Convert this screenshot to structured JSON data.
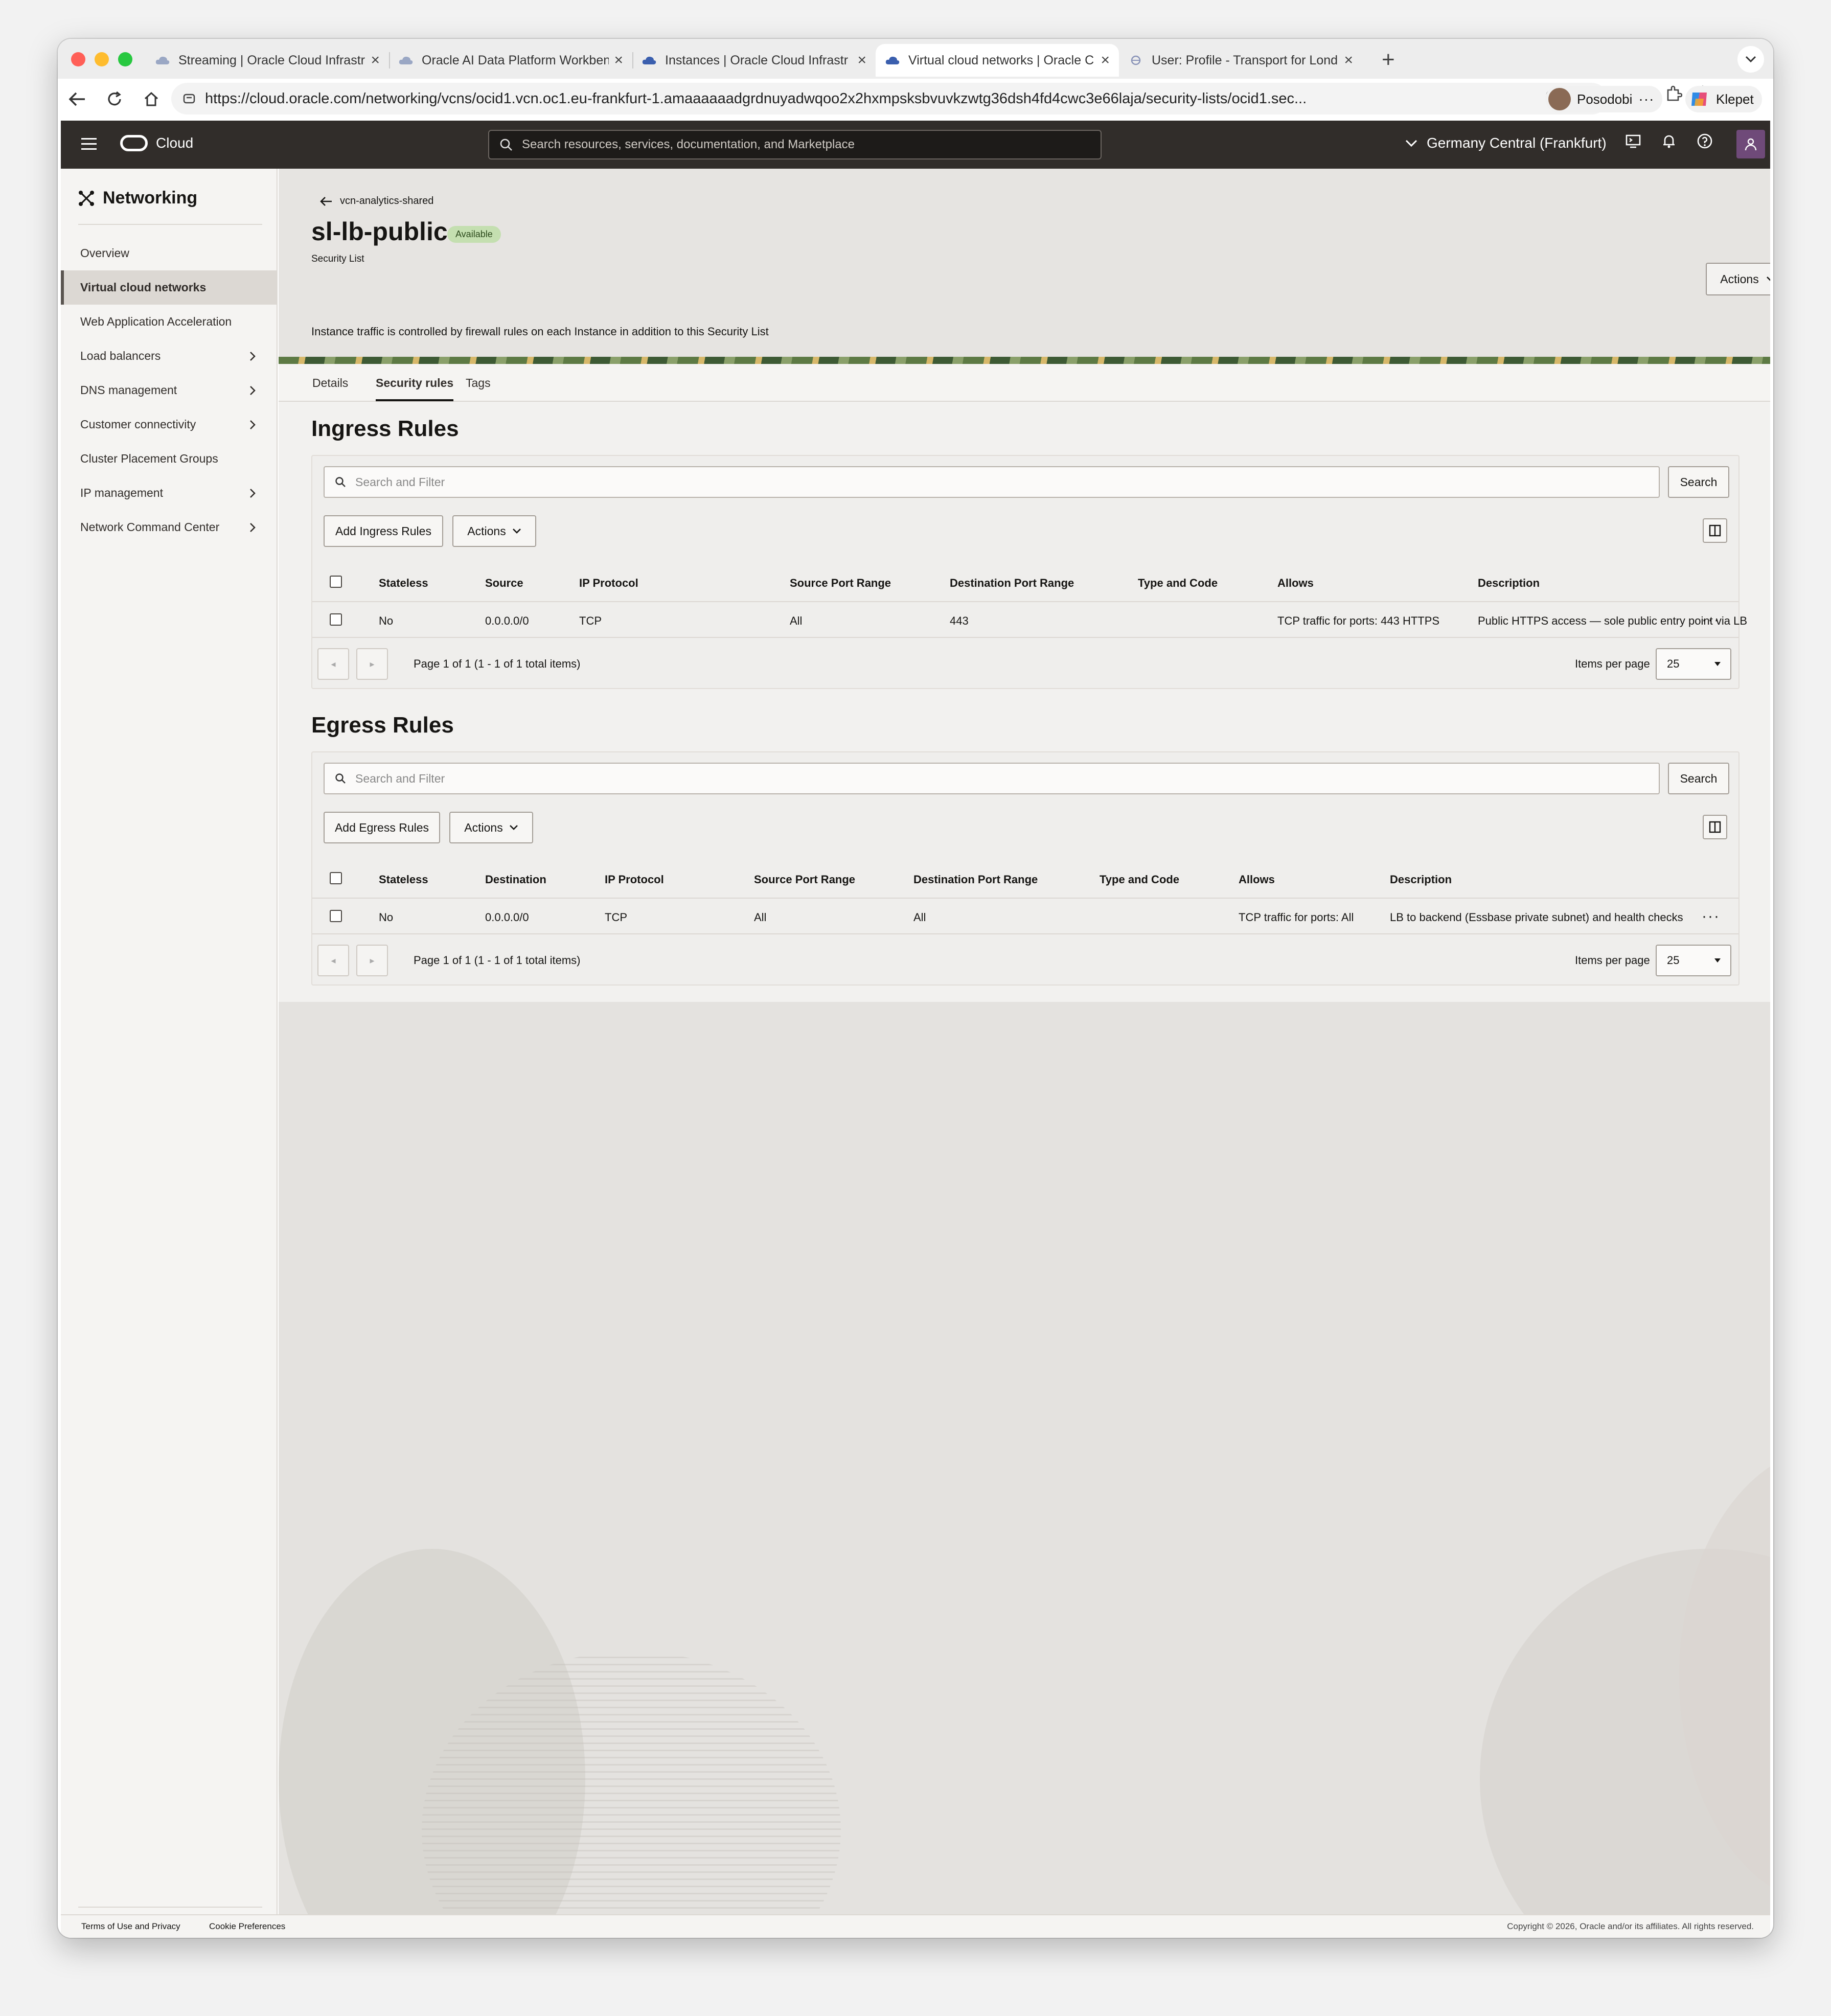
{
  "browser": {
    "tabs": [
      {
        "title": "Streaming | Oracle Cloud Infrastr",
        "active": false
      },
      {
        "title": "Oracle AI Data Platform Workben",
        "active": false
      },
      {
        "title": "Instances | Oracle Cloud Infrastr",
        "active": false
      },
      {
        "title": "Virtual cloud networks | Oracle C",
        "active": true
      },
      {
        "title": "User: Profile - Transport for Lond",
        "active": false
      }
    ],
    "url": "https://cloud.oracle.com/networking/vcns/ocid1.vcn.oc1.eu-frankfurt-1.amaaaaaadgrdnuyadwqoo2x2hxmpsksbvuvkzwtg36dsh4fd4cwc3e66laja/security-lists/ocid1.sec...",
    "profile_name": "Posodobi",
    "copilot_label": "Klepet"
  },
  "header": {
    "brand": "Cloud",
    "search_placeholder": "Search resources, services, documentation, and Marketplace",
    "region": "Germany Central (Frankfurt)"
  },
  "sidebar": {
    "title": "Networking",
    "items": [
      {
        "label": "Overview",
        "active": false,
        "has_children": false
      },
      {
        "label": "Virtual cloud networks",
        "active": true,
        "has_children": false
      },
      {
        "label": "Web Application Acceleration",
        "active": false,
        "has_children": false
      },
      {
        "label": "Load balancers",
        "active": false,
        "has_children": true
      },
      {
        "label": "DNS management",
        "active": false,
        "has_children": true
      },
      {
        "label": "Customer connectivity",
        "active": false,
        "has_children": true
      },
      {
        "label": "Cluster Placement Groups",
        "active": false,
        "has_children": false
      },
      {
        "label": "IP management",
        "active": false,
        "has_children": true
      },
      {
        "label": "Network Command Center",
        "active": false,
        "has_children": true
      }
    ]
  },
  "page": {
    "back_label": "vcn-analytics-shared",
    "title": "sl-lb-public",
    "status": "Available",
    "subtitle": "Security List",
    "description": "Instance traffic is controlled by firewall rules on each Instance in addition to this Security List",
    "actions_label": "Actions",
    "tabs": [
      "Details",
      "Security rules",
      "Tags"
    ],
    "active_tab": "Security rules"
  },
  "ingress": {
    "title": "Ingress Rules",
    "filter_placeholder": "Search and Filter",
    "search_label": "Search",
    "add_label": "Add Ingress Rules",
    "actions_label": "Actions",
    "columns": [
      "Stateless",
      "Source",
      "IP Protocol",
      "Source Port Range",
      "Destination Port Range",
      "Type and Code",
      "Allows",
      "Description"
    ],
    "rows": [
      [
        "No",
        "0.0.0.0/0",
        "TCP",
        "All",
        "443",
        "",
        "TCP traffic for ports: 443 HTTPS",
        "Public HTTPS access — sole public entry point via LB"
      ]
    ],
    "page_info": "Page 1 of 1 (1 - 1 of 1 total items)",
    "items_per_page_label": "Items per page",
    "items_per_page": "25"
  },
  "egress": {
    "title": "Egress Rules",
    "filter_placeholder": "Search and Filter",
    "search_label": "Search",
    "add_label": "Add Egress Rules",
    "actions_label": "Actions",
    "columns": [
      "Stateless",
      "Destination",
      "IP Protocol",
      "Source Port Range",
      "Destination Port Range",
      "Type and Code",
      "Allows",
      "Description"
    ],
    "rows": [
      [
        "No",
        "0.0.0.0/0",
        "TCP",
        "All",
        "All",
        "",
        "TCP traffic for ports: All",
        "LB to backend (Essbase private subnet) and health checks"
      ]
    ],
    "page_info": "Page 1 of 1 (1 - 1 of 1 total items)",
    "items_per_page_label": "Items per page",
    "items_per_page": "25"
  },
  "footer": {
    "terms": "Terms of Use and Privacy",
    "cookies": "Cookie Preferences",
    "copyright": "Copyright © 2026, Oracle and/or its affiliates. All rights reserved."
  },
  "colors": {
    "header_bg": "#312d2a",
    "badge_bg": "#c4dfb0",
    "user_tile": "#6f4a79"
  }
}
